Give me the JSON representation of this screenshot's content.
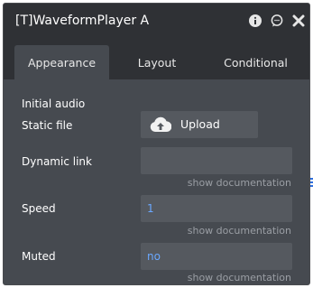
{
  "panel": {
    "title": "[T]WaveformPlayer A",
    "icons": [
      "info-icon",
      "comment-icon",
      "close-icon"
    ]
  },
  "tabs": [
    {
      "label": "Appearance",
      "active": true
    },
    {
      "label": "Layout",
      "active": false
    },
    {
      "label": "Conditional",
      "active": false
    }
  ],
  "section": {
    "title": "Initial audio"
  },
  "static_file": {
    "label": "Static file",
    "button_label": "Upload",
    "icon": "cloud-upload-icon"
  },
  "dynamic_link": {
    "label": "Dynamic link",
    "value": "",
    "doc_link": "show documentation"
  },
  "speed": {
    "label": "Speed",
    "value": "1",
    "doc_link": "show documentation"
  },
  "muted": {
    "label": "Muted",
    "value": "no",
    "doc_link": "show documentation"
  },
  "colors": {
    "panel_bg": "#2f3135",
    "content_bg": "#464a50",
    "field_bg": "#55595f",
    "value_text": "#6aa8ff"
  }
}
